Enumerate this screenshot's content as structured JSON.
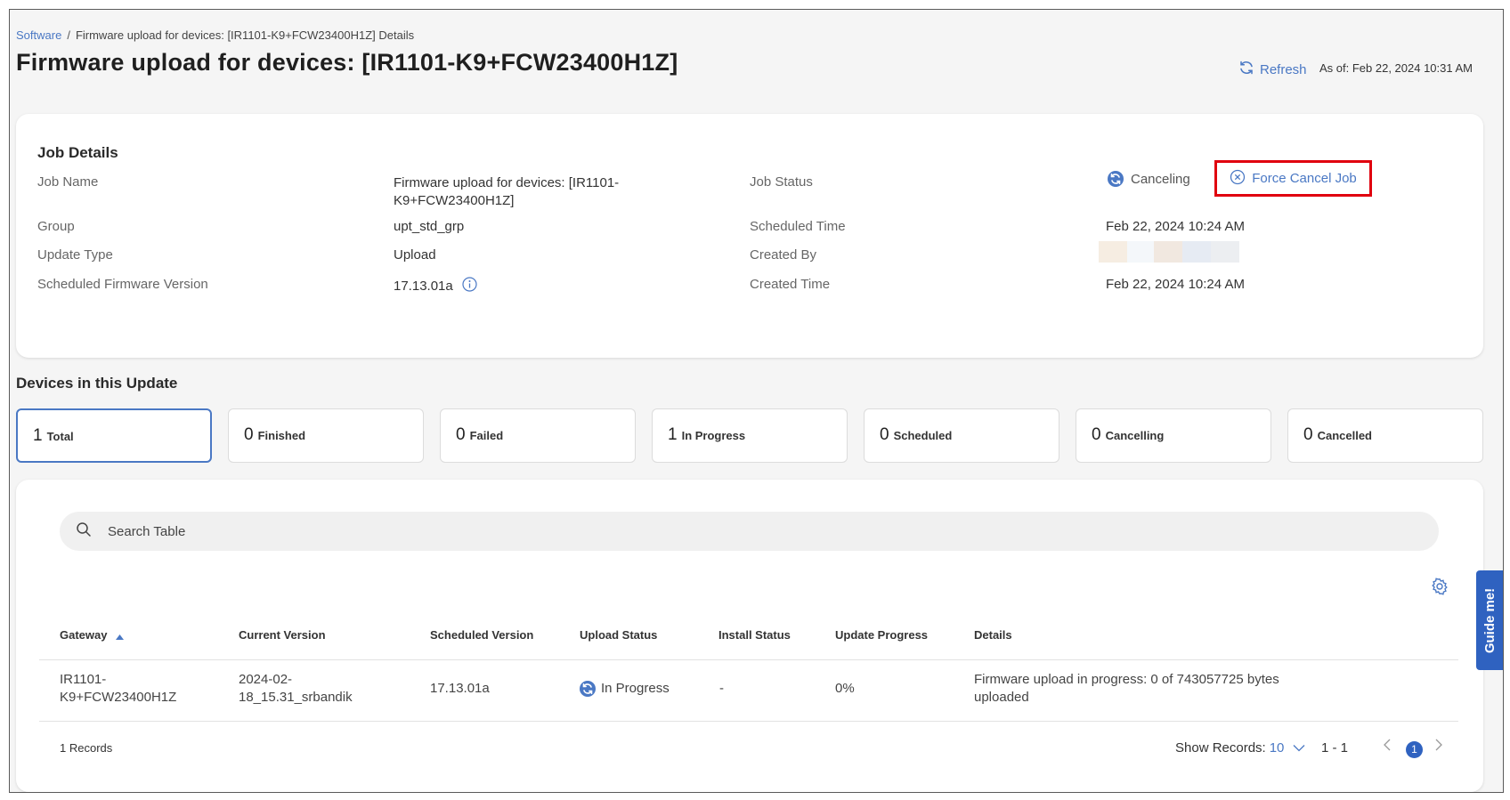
{
  "breadcrumb": {
    "root": "Software",
    "separator": "/",
    "current": "Firmware upload for devices: [IR1101-K9+FCW23400H1Z] Details"
  },
  "page_title": "Firmware upload for devices: [IR1101-K9+FCW23400H1Z]",
  "header": {
    "refresh_label": "Refresh",
    "as_of": "As of: Feb 22, 2024 10:31 AM"
  },
  "job_details": {
    "title": "Job Details",
    "job_name_label": "Job Name",
    "job_name_line1": "Firmware upload for devices: [IR1101-",
    "job_name_line2": "K9+FCW23400H1Z]",
    "group_label": "Group",
    "group_value": "upt_std_grp",
    "update_type_label": "Update Type",
    "update_type_value": "Upload",
    "firmware_label": "Scheduled Firmware Version",
    "firmware_value": "17.13.01a",
    "job_status_label": "Job Status",
    "job_status_value": "Canceling",
    "force_cancel_label": "Force Cancel Job",
    "scheduled_time_label": "Scheduled Time",
    "scheduled_time_value": "Feb 22, 2024 10:24 AM",
    "created_by_label": "Created By",
    "created_time_label": "Created Time",
    "created_time_value": "Feb 22, 2024 10:24 AM"
  },
  "devices": {
    "title": "Devices in this Update",
    "stats": [
      {
        "count": "1",
        "label": "Total"
      },
      {
        "count": "0",
        "label": "Finished"
      },
      {
        "count": "0",
        "label": "Failed"
      },
      {
        "count": "1",
        "label": "In Progress"
      },
      {
        "count": "0",
        "label": "Scheduled"
      },
      {
        "count": "0",
        "label": "Cancelling"
      },
      {
        "count": "0",
        "label": "Cancelled"
      }
    ]
  },
  "table": {
    "search_placeholder": "Search Table",
    "columns": [
      "Gateway",
      "Current Version",
      "Scheduled Version",
      "Upload Status",
      "Install Status",
      "Update Progress",
      "Details"
    ],
    "rows": [
      {
        "gateway_line1": "IR1101-",
        "gateway_line2": "K9+FCW23400H1Z",
        "current_line1": "2024-02-",
        "current_line2": "18_15.31_srbandik",
        "scheduled": "17.13.01a",
        "upload_status": "In Progress",
        "install_status": "-",
        "progress": "0%",
        "details_line1": "Firmware upload in progress: 0 of 743057725 bytes",
        "details_line2": "uploaded"
      }
    ],
    "records": "1 Records",
    "show_records_label": "Show Records:",
    "show_records_value": "10",
    "range": "1 - 1",
    "current_page": "1"
  },
  "guide_label": "Guide me!",
  "colors": {
    "accent": "#4a78c4",
    "highlight_box": "#e0000e",
    "page_bg": "#f5f5f5"
  }
}
